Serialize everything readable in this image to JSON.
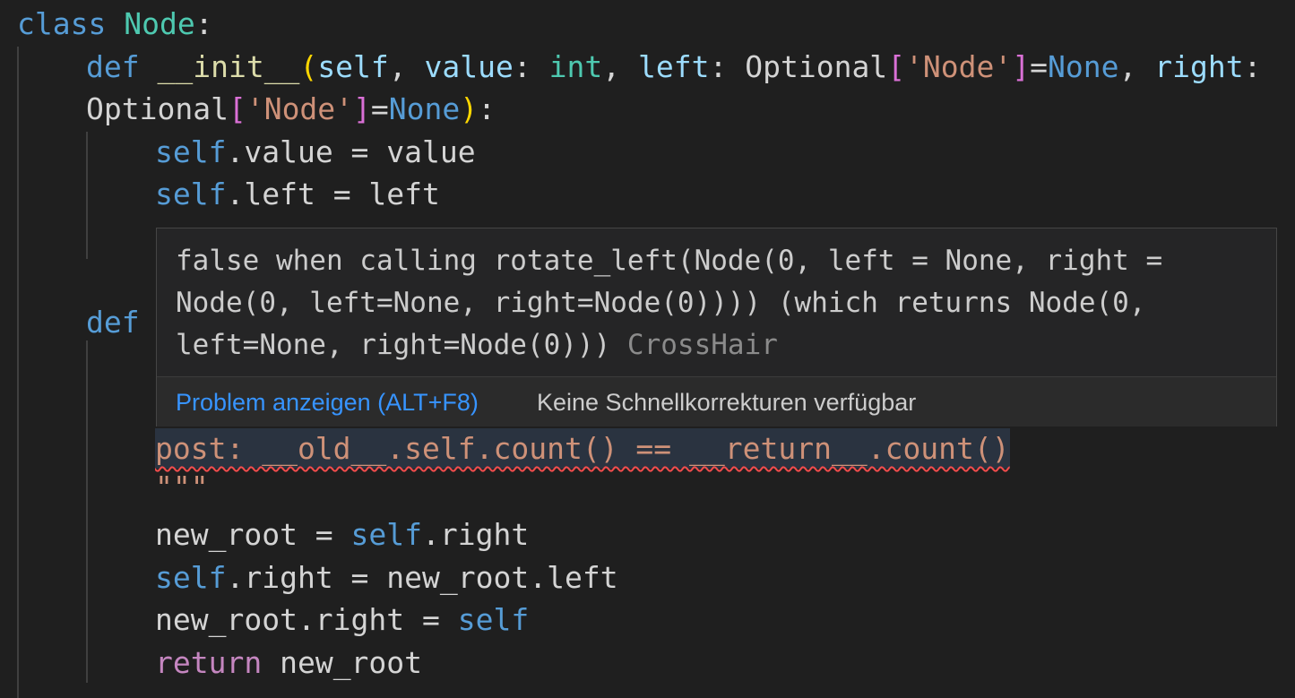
{
  "code": {
    "l1": {
      "kw": "class",
      "name": "Node",
      "colon": ":"
    },
    "l2": {
      "def": "def",
      "fn": "__init__",
      "open": "(",
      "self": "self",
      "comma1": ", ",
      "p_value": "value",
      "colon1": ": ",
      "int": "int",
      "comma2": ", ",
      "p_left": "left",
      "colon2": ": ",
      "optional": "Optional",
      "lb": "[",
      "node_str": "'Node'",
      "rb": "]",
      "eq": "=",
      "none": "None",
      "comma3": ", ",
      "p_right": "right",
      "colon3": ":"
    },
    "l3": {
      "optional": "Optional",
      "lb": "[",
      "node_str": "'Node'",
      "rb": "]",
      "eq": "=",
      "none": "None",
      "close": ")",
      "colon": ":"
    },
    "l4": {
      "self": "self",
      "rest": ".value = value"
    },
    "l5": {
      "self": "self",
      "rest": ".left = left"
    },
    "l6": {
      "def": "def"
    },
    "l7": {
      "post": "post: __old__.self.count() == __return__.count()"
    },
    "l8": {
      "quotes": "\"\"\""
    },
    "l9": {
      "a": "new_root = ",
      "self": "self",
      "b": ".right"
    },
    "l10": {
      "self": "self",
      "rest": ".right = new_root.left"
    },
    "l11": {
      "a": "new_root.right = ",
      "self": "self"
    },
    "l12": {
      "ret": "return",
      "rest": " new_root"
    }
  },
  "hover": {
    "message_line1": "false when calling rotate_left(Node(0, left = None, right =",
    "message_line2": "Node(0, left=None, right=Node(0)))) (which returns Node(0,",
    "message_line3": "left=None, right=Node(0))) ",
    "source": "CrossHair",
    "view_problem": "Problem anzeigen (ALT+F8)",
    "no_quick_fixes": "Keine Schnellkorrekturen verfügbar"
  },
  "colors": {
    "background": "#1f1f1f",
    "keyword": "#569cd6",
    "class_name": "#4ec9b0",
    "function": "#dcdcaa",
    "parameter": "#9cdcfe",
    "string": "#ce9178",
    "control": "#c586c0",
    "error_squiggle": "#f14c4c",
    "link": "#3794ff"
  }
}
